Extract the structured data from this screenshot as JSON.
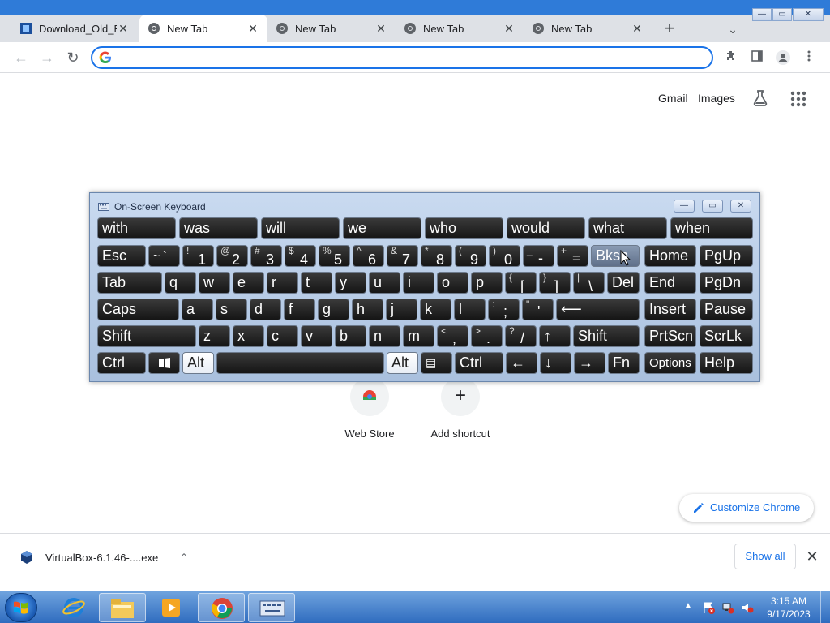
{
  "browser": {
    "tabs": [
      {
        "title": "Download_Old_Bu",
        "icon": "virtualbox-site-icon",
        "active": false
      },
      {
        "title": "New Tab",
        "icon": "chrome-icon",
        "active": true
      },
      {
        "title": "New Tab",
        "icon": "chrome-icon",
        "active": false
      },
      {
        "title": "New Tab",
        "icon": "chrome-icon",
        "active": false
      },
      {
        "title": "New Tab",
        "icon": "chrome-icon",
        "active": false
      }
    ],
    "new_tab_symbol": "+",
    "tab_search_symbol": "⌄",
    "window_buttons": {
      "minimize": "—",
      "maximize": "▭",
      "close": "✕"
    },
    "omnibox": {
      "value": "",
      "placeholder": ""
    },
    "nav": {
      "back": "←",
      "forward": "→",
      "reload": "↻"
    }
  },
  "ntp": {
    "top_links": {
      "gmail": "Gmail",
      "images": "Images"
    },
    "shortcuts": [
      {
        "label": "Web Store",
        "icon": "chrome-web-store-icon"
      },
      {
        "label": "Add shortcut",
        "icon": "plus-icon",
        "symbol": "+"
      }
    ],
    "customize_label": "Customize Chrome"
  },
  "downloads": {
    "item_name": "VirtualBox-6.1.46-....exe",
    "chevron": "⌃",
    "show_all": "Show all",
    "close": "✕"
  },
  "osk": {
    "title": "On-Screen Keyboard",
    "caption_buttons": {
      "minimize": "—",
      "restore": "▭",
      "close": "✕"
    },
    "predictions": [
      "with",
      "was",
      "will",
      "we",
      "who",
      "would",
      "what",
      "when"
    ],
    "row1": [
      {
        "main": "Esc"
      },
      {
        "main": "~ `"
      },
      {
        "sub": "!",
        "main": "1"
      },
      {
        "sub": "@",
        "main": "2"
      },
      {
        "sub": "#",
        "main": "3"
      },
      {
        "sub": "$",
        "main": "4"
      },
      {
        "sub": "%",
        "main": "5"
      },
      {
        "sub": "^",
        "main": "6"
      },
      {
        "sub": "&",
        "main": "7"
      },
      {
        "sub": "*",
        "main": "8"
      },
      {
        "sub": "(",
        "main": "9"
      },
      {
        "sub": ")",
        "main": "0"
      },
      {
        "sub": "_",
        "main": "-"
      },
      {
        "sub": "+",
        "main": "="
      },
      {
        "main": "Bksp"
      },
      {
        "main": "Home"
      },
      {
        "main": "PgUp"
      }
    ],
    "row2": [
      {
        "main": "Tab"
      },
      {
        "main": "q"
      },
      {
        "main": "w"
      },
      {
        "main": "e"
      },
      {
        "main": "r"
      },
      {
        "main": "t"
      },
      {
        "main": "y"
      },
      {
        "main": "u"
      },
      {
        "main": "i"
      },
      {
        "main": "o"
      },
      {
        "main": "p"
      },
      {
        "sub": "{",
        "main": "["
      },
      {
        "sub": "}",
        "main": "]"
      },
      {
        "sub": "|",
        "main": "\\"
      },
      {
        "main": "Del"
      },
      {
        "main": "End"
      },
      {
        "main": "PgDn"
      }
    ],
    "row3": [
      {
        "main": "Caps"
      },
      {
        "main": "a"
      },
      {
        "main": "s"
      },
      {
        "main": "d"
      },
      {
        "main": "f"
      },
      {
        "main": "g"
      },
      {
        "main": "h"
      },
      {
        "main": "j"
      },
      {
        "main": "k"
      },
      {
        "main": "l"
      },
      {
        "sub": ":",
        "main": ";"
      },
      {
        "sub": "\"",
        "main": "'"
      },
      {
        "main": "⟵"
      },
      {
        "main": "Insert"
      },
      {
        "main": "Pause"
      }
    ],
    "row4": [
      {
        "main": "Shift"
      },
      {
        "main": "z"
      },
      {
        "main": "x"
      },
      {
        "main": "c"
      },
      {
        "main": "v"
      },
      {
        "main": "b"
      },
      {
        "main": "n"
      },
      {
        "main": "m"
      },
      {
        "sub": "<",
        "main": ","
      },
      {
        "sub": ">",
        "main": "."
      },
      {
        "sub": "?",
        "main": "/"
      },
      {
        "main": "↑"
      },
      {
        "main": "Shift"
      },
      {
        "main": "PrtScn"
      },
      {
        "main": "ScrLk"
      }
    ],
    "row5": [
      {
        "main": "Ctrl"
      },
      {
        "main": "⊞"
      },
      {
        "main": "Alt"
      },
      {
        "main": ""
      },
      {
        "main": "Alt"
      },
      {
        "main": "▤"
      },
      {
        "main": "Ctrl"
      },
      {
        "main": "←"
      },
      {
        "main": "↓"
      },
      {
        "main": "→"
      },
      {
        "main": "Fn"
      },
      {
        "main": "Options"
      },
      {
        "main": "Help"
      }
    ]
  },
  "taskbar": {
    "items": [
      {
        "name": "internet-explorer-icon"
      },
      {
        "name": "file-explorer-icon"
      },
      {
        "name": "media-player-icon"
      },
      {
        "name": "chrome-icon"
      },
      {
        "name": "on-screen-keyboard-icon"
      }
    ],
    "tray_arrow": "▲",
    "time": "3:15 AM",
    "date": "9/17/2023"
  },
  "colors": {
    "accent": "#1a73e8",
    "taskbar": "#2f6cbf",
    "osk_key": "#1e1e1e"
  }
}
